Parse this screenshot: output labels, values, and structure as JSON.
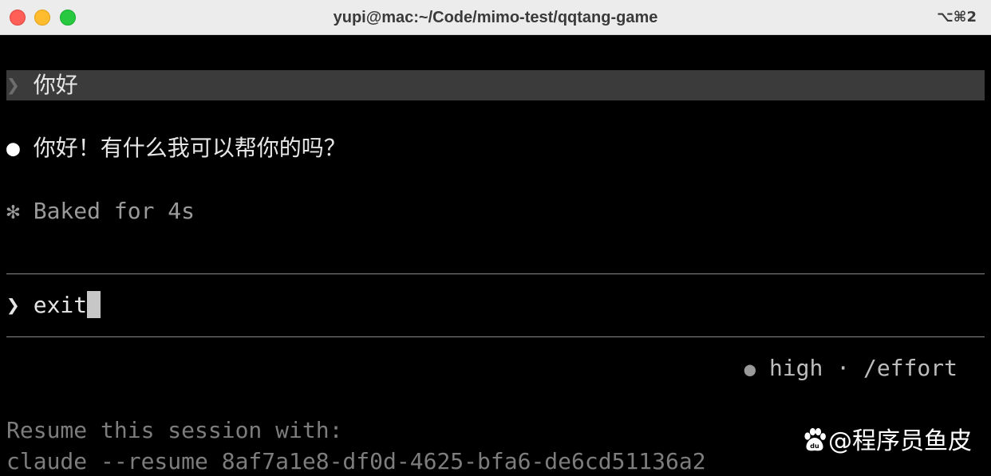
{
  "window": {
    "title": "yupi@mac:~/Code/mimo-test/qqtang-game",
    "shortcut": "⌥⌘2"
  },
  "terminal": {
    "prev_prompt": {
      "chevron": "❯",
      "text": "你好"
    },
    "response": {
      "bullet": "●",
      "text": "你好！有什么我可以帮你的吗？"
    },
    "timing": {
      "symbol": "✻",
      "text": "Baked for 4s"
    },
    "input": {
      "chevron": "❯",
      "value": "exit"
    },
    "status": {
      "dot": "●",
      "level": "high",
      "separator": "·",
      "command": "/effort"
    },
    "resume_hint": "Resume this session with:",
    "resume_command": "claude --resume 8af7a1e8-df0d-4625-bfa6-de6cd51136a2"
  },
  "watermark": {
    "text": "@程序员鱼皮",
    "icon": "baidu-paw-icon"
  },
  "colors": {
    "terminal_bg": "#000000",
    "titlebar_bg": "#ececec",
    "prompt_highlight": "#3b3b3b",
    "close": "#ff5f57",
    "minimize": "#febc2e",
    "maximize": "#28c840"
  }
}
